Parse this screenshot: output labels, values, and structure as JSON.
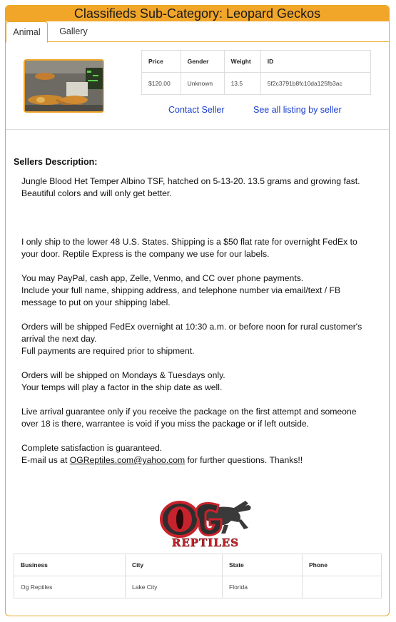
{
  "header": {
    "title": "Classifieds Sub-Category: Leopard Geckos"
  },
  "tabs": [
    {
      "label": "Animal"
    },
    {
      "label": "Gallery"
    }
  ],
  "listing": {
    "headers": [
      "Price",
      "Gender",
      "Weight",
      "ID"
    ],
    "values": [
      "$120.00",
      "Unknown",
      "13.5",
      "5f2c3791b8fc10da125fb3ac"
    ]
  },
  "links": {
    "contact": "Contact Seller",
    "see_all": "See all listing by seller"
  },
  "description": {
    "title": "Sellers Description:",
    "p1": "Jungle Blood Het Temper Albino TSF, hatched on 5-13-20. 13.5 grams and growing fast. Beautiful colors and will only get better.",
    "p2": "I only ship to the lower 48 U.S. States. Shipping is a $50 flat rate for overnight FedEx to your door. Reptile Express is the company we use for our labels.",
    "p3a": "You may PayPal, cash app, Zelle, Venmo, and CC over phone payments.",
    "p3b": "Include your full name, shipping address, and telephone number via email/text / FB message to put on your shipping label.",
    "p4a": "Orders will be shipped FedEx overnight at 10:30 a.m. or before noon for rural customer's arrival the next day.",
    "p4b": "Full payments are required prior to shipment.",
    "p5a": "Orders will be shipped on Mondays & Tuesdays only.",
    "p5b": "Your temps will play a factor in the ship date as well.",
    "p6": "Live arrival guarantee only if you receive the package on the first attempt and someone over 18 is there, warrantee is void if you miss the package or if left outside.",
    "p7": "Complete satisfaction is guaranteed.",
    "p8_prefix": "E-mail us at ",
    "p8_email": "OGReptiles.com@yahoo.com",
    "p8_suffix": " for further questions. Thanks!!"
  },
  "logo": {
    "text_top": "OG",
    "text_bottom": "REPTILES"
  },
  "business": {
    "headers": [
      "Business",
      "City",
      "State",
      "Phone"
    ],
    "values": [
      "Og Reptiles",
      "Lake City",
      "Florida",
      ""
    ]
  },
  "colors": {
    "accent": "#f1a62a",
    "link": "#1b3fcf",
    "logo_red": "#c8232c"
  }
}
